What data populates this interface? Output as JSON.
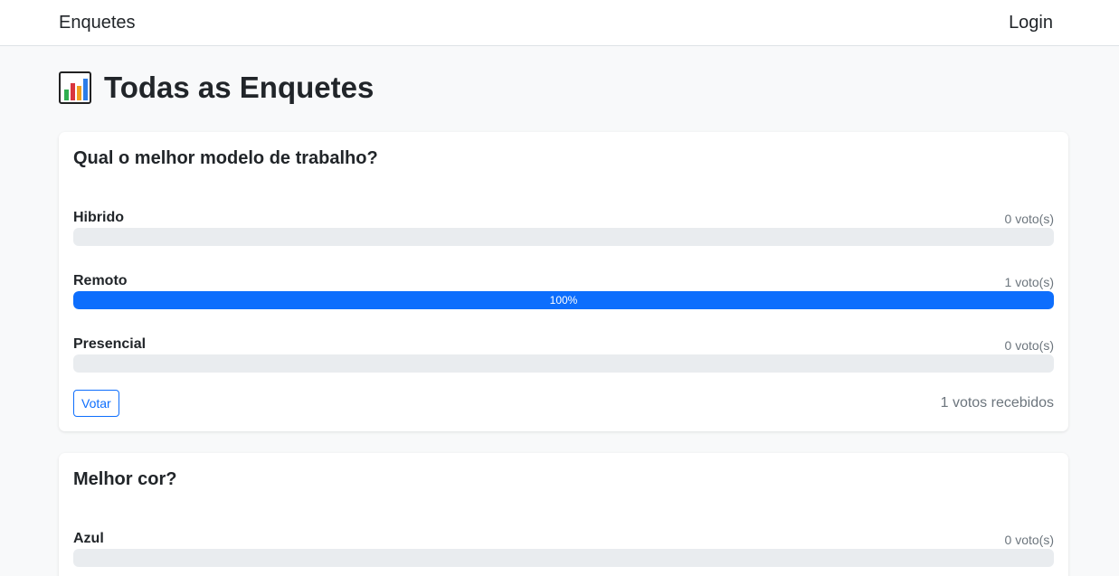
{
  "navbar": {
    "brand": "Enquetes",
    "login": "Login"
  },
  "page": {
    "title": "Todas as Enquetes",
    "icon": "bar-chart-icon"
  },
  "polls": [
    {
      "question": "Qual o melhor modelo de trabalho?",
      "options": [
        {
          "label": "Hibrido",
          "votes_text": "0 voto(s)",
          "percent": 0,
          "percent_text": ""
        },
        {
          "label": "Remoto",
          "votes_text": "1 voto(s)",
          "percent": 100,
          "percent_text": "100%"
        },
        {
          "label": "Presencial",
          "votes_text": "0 voto(s)",
          "percent": 0,
          "percent_text": ""
        }
      ],
      "vote_button": "Votar",
      "total_text": "1 votos recebidos"
    },
    {
      "question": "Melhor cor?",
      "options": [
        {
          "label": "Azul",
          "votes_text": "0 voto(s)",
          "percent": 0,
          "percent_text": ""
        }
      ]
    }
  ],
  "colors": {
    "accent": "#0d6efd",
    "track": "#e9ecef",
    "muted": "#6c757d"
  }
}
